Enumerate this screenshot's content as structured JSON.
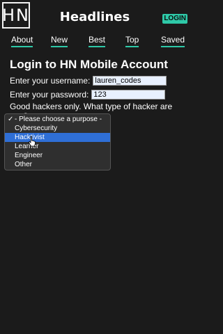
{
  "header": {
    "logo_text": "HN",
    "title": "Headlines",
    "login_label": "LOGIN"
  },
  "nav": {
    "items": [
      "About",
      "New",
      "Best",
      "Top",
      "Saved"
    ]
  },
  "form": {
    "title": "Login to HN Mobile Account",
    "username_label": "Enter your username:",
    "username_value": "lauren_codes",
    "password_label": "Enter your password:",
    "password_value": "123",
    "question": "Good hackers only. What type of hacker are you?"
  },
  "dropdown": {
    "check": "✓",
    "options": [
      "- Please choose a purpose -",
      "Cybersecurity",
      "Hacktivist",
      "Learner",
      "Engineer",
      "Other"
    ],
    "highlighted": "Hacktivist"
  },
  "colors": {
    "background": "#1b1b1b",
    "accent": "#2ec9a8",
    "highlight": "#2f6fd6"
  },
  "icons": [
    "pointer-cursor-icon"
  ]
}
